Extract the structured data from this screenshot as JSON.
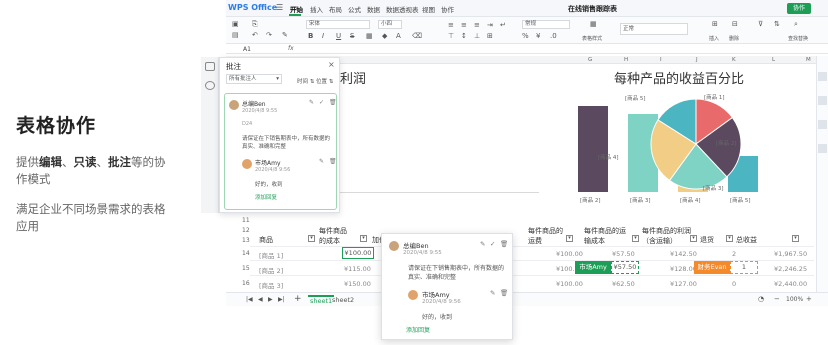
{
  "promo": {
    "title": "表格协作",
    "desc_pre": "提供",
    "desc_b1": "编辑",
    "desc_s1": "、",
    "desc_b2": "只读",
    "desc_s2": "、",
    "desc_b3": "批注",
    "desc_post": "等的协作模式",
    "sub": "满足企业不同场景需求的表格应用"
  },
  "app": {
    "logo": "WPS Office",
    "menu": [
      "开始",
      "插入",
      "布局",
      "公式",
      "数据",
      "数据透视表",
      "视图",
      "协作"
    ],
    "doc_title": "在线销售跟踪表",
    "collab_label": "协作",
    "cell_ref": "A1",
    "fx": "fx",
    "font_name": "宋体",
    "font_size": "小四",
    "number_format": "常规",
    "style_label": "表格样式",
    "normal_label": "正常",
    "insert_label": "插入",
    "delete_label": "删除",
    "find_label": "查找替换",
    "columns": [
      "A",
      "B",
      "C",
      "D",
      "E",
      "F",
      "G",
      "H",
      "I",
      "J",
      "K",
      "L",
      "M",
      "N",
      "O",
      "P",
      "Q",
      "R",
      "S",
      "T"
    ],
    "row_numbers": [
      "11",
      "12",
      "13",
      "14",
      "15",
      "16"
    ],
    "sheets": [
      "sheet1",
      "sheet2"
    ],
    "zoom": "100%"
  },
  "chart_data": [
    {
      "type": "bar",
      "title": "利润",
      "categories": [
        "[商品 2]",
        "[商品 3]",
        "[商品 4]",
        "[商品 5]"
      ],
      "values": [
        100,
        90,
        45,
        42
      ],
      "colors": [
        "#5b4a5f",
        "#7fd3c4",
        "#f2cd86",
        "#4bb5c1"
      ],
      "ylim": [
        0,
        110
      ]
    },
    {
      "type": "pie",
      "title": "每种产品的收益百分比",
      "labels": [
        "[商品 1]",
        "[商品 2]",
        "[商品 3]",
        "[商品 4]",
        "[商品 5]"
      ],
      "values": [
        15,
        23,
        22,
        24,
        16
      ],
      "colors": [
        "#e96a6a",
        "#5b4a5f",
        "#7fd3c4",
        "#f2cd86",
        "#4bb5c1"
      ]
    }
  ],
  "table": {
    "headers": [
      "商品",
      "每件商品的成本",
      "加价",
      "每件商品的运费",
      "每件商品的运输成本",
      "每件商品的利润（含运输）",
      "退货",
      "总收益"
    ],
    "rows": [
      {
        "name": "[商品 1]",
        "cost": "¥100.00",
        "ship": "¥100.00",
        "trans": "¥57.50",
        "profit": "¥142.50",
        "ret": "2",
        "total": "¥1,967.50"
      },
      {
        "name": "[商品 2]",
        "cost": "¥115.00",
        "ship": "¥100.00",
        "trans": "¥57.50",
        "profit": "¥128.00",
        "ret": "1",
        "total": "¥2,246.25"
      },
      {
        "name": "[商品 3]",
        "cost": "¥150.00",
        "ship": "¥100.00",
        "trans": "¥62.50",
        "profit": "¥127.00",
        "ret": "0",
        "total": "¥2,440.00"
      }
    ]
  },
  "comments": {
    "panel_title": "批注",
    "filter": "所有批注人",
    "sort_time": "时间",
    "sort_pos": "位置",
    "cell_ref": "D24",
    "c1_author": "总编Ben",
    "c1_time": "2020/4/8 9:55",
    "c1_text": "请保证在下销售期表中，所有数据的真实、准确和完整",
    "c2_author": "市场Amy",
    "c2_time": "2020/4/8 9:56",
    "c2_text": "好的，收到",
    "add_reply": "添加回复",
    "tag_amy": "市场Amy",
    "tag_evan": "财务Evan"
  }
}
